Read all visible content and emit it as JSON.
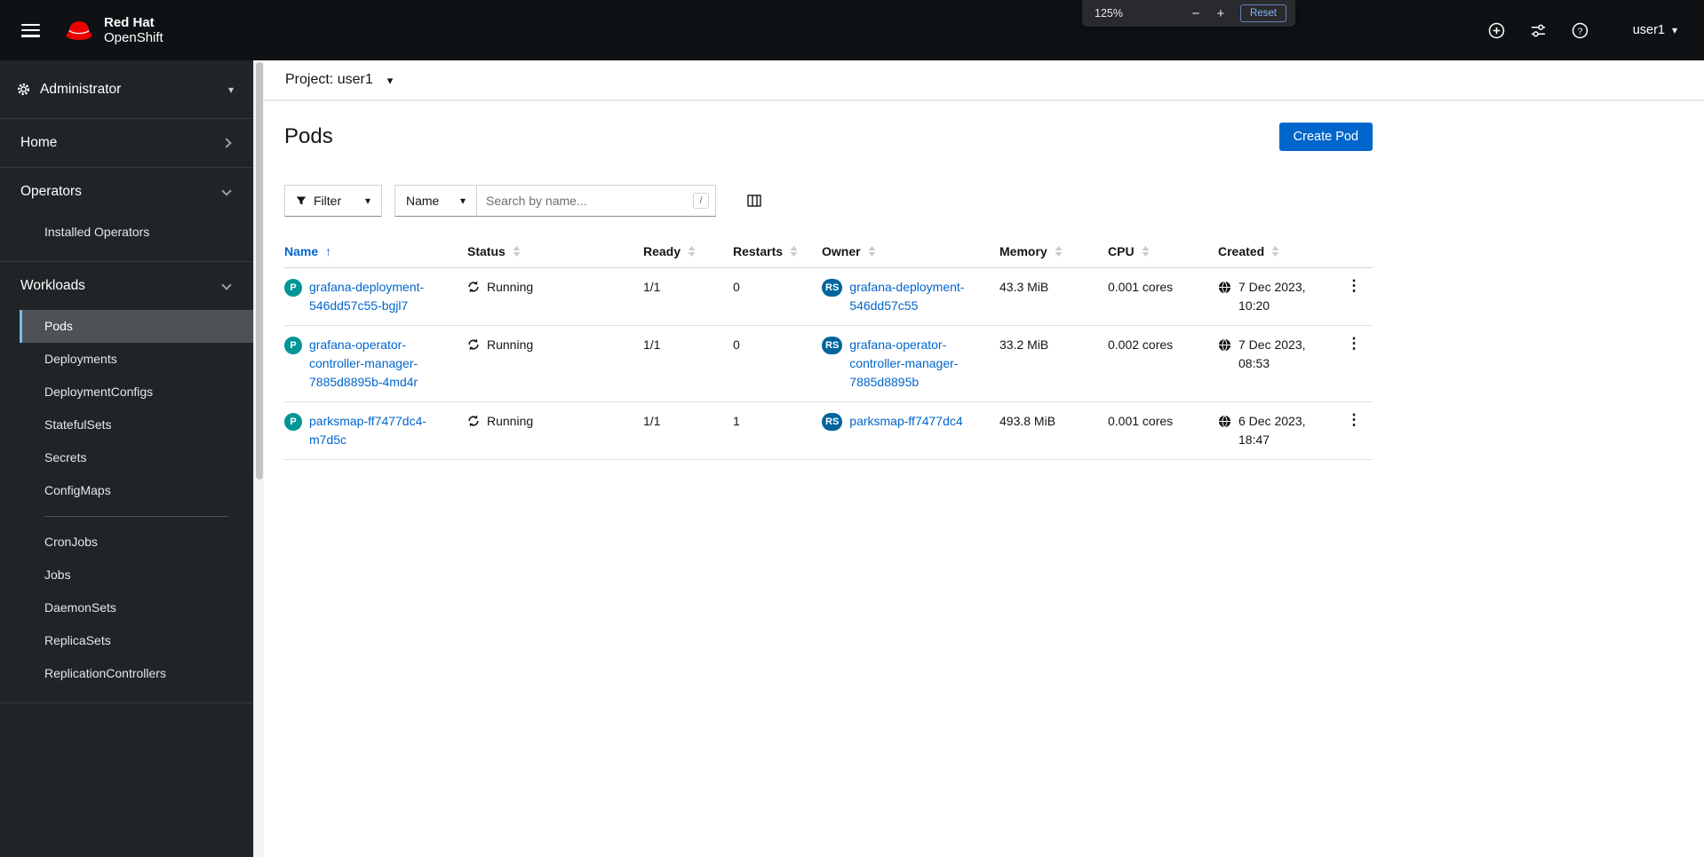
{
  "masthead": {
    "brand_line1": "Red Hat",
    "brand_line2": "OpenShift",
    "username": "user1"
  },
  "zoom_overlay": {
    "level": "125%",
    "minus": "−",
    "plus": "+",
    "reset": "Reset"
  },
  "glyphs": {
    "caret_down": "▾",
    "kebab": "⋮",
    "sort_ascending": "↑"
  },
  "sidebar": {
    "perspective": "Administrator",
    "home": "Home",
    "operators": "Operators",
    "installed_operators": "Installed Operators",
    "workloads": "Workloads",
    "workloads_items": [
      "Pods",
      "Deployments",
      "DeploymentConfigs",
      "StatefulSets",
      "Secrets",
      "ConfigMaps",
      "CronJobs",
      "Jobs",
      "DaemonSets",
      "ReplicaSets",
      "ReplicationControllers"
    ],
    "active_item": "Pods"
  },
  "project_bar": {
    "label": "Project: user1"
  },
  "page": {
    "title": "Pods",
    "create_button": "Create Pod"
  },
  "toolbar": {
    "filter": "Filter",
    "attribute": "Name",
    "search_placeholder": "Search by name...",
    "search_shortcut": "/"
  },
  "table": {
    "columns": {
      "name": "Name",
      "status": "Status",
      "ready": "Ready",
      "restarts": "Restarts",
      "owner": "Owner",
      "memory": "Memory",
      "cpu": "CPU",
      "created": "Created"
    },
    "badges": {
      "pod": "P",
      "replicaset": "RS"
    },
    "rows": [
      {
        "name": "grafana-deployment-546dd57c55-bgjl7",
        "status": "Running",
        "ready": "1/1",
        "restarts": "0",
        "owner": "grafana-deployment-546dd57c55",
        "memory": "43.3 MiB",
        "cpu": "0.001 cores",
        "created": "7 Dec 2023, 10:20"
      },
      {
        "name": "grafana-operator-controller-manager-7885d8895b-4md4r",
        "status": "Running",
        "ready": "1/1",
        "restarts": "0",
        "owner": "grafana-operator-controller-manager-7885d8895b",
        "memory": "33.2 MiB",
        "cpu": "0.002 cores",
        "created": "7 Dec 2023, 08:53"
      },
      {
        "name": "parksmap-ff7477dc4-m7d5c",
        "status": "Running",
        "ready": "1/1",
        "restarts": "1",
        "owner": "parksmap-ff7477dc4",
        "memory": "493.8 MiB",
        "cpu": "0.001 cores",
        "created": "6 Dec 2023, 18:47"
      }
    ]
  },
  "colors": {
    "link": "#0066cc",
    "primary": "#0066cc",
    "pod_badge": "#009596",
    "rs_badge": "#00659c",
    "masthead": "#0f1214",
    "sidebar": "#212427",
    "nav_current": "#4f5255",
    "nav_accent": "#73bcf7",
    "brand_red": "#ee0000"
  }
}
